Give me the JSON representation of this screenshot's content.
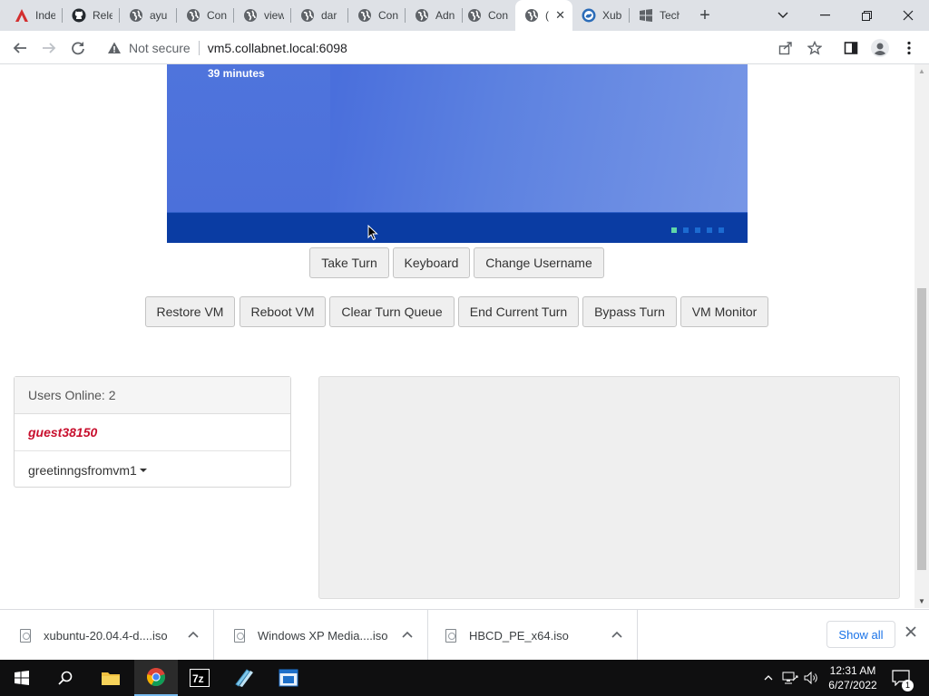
{
  "browser": {
    "tabs": [
      {
        "title": "Inde",
        "icon": "brand-a-icon"
      },
      {
        "title": "Rele",
        "icon": "github-icon"
      },
      {
        "title": "ayu",
        "icon": "globe-icon"
      },
      {
        "title": "Con",
        "icon": "globe-icon"
      },
      {
        "title": "view",
        "icon": "globe-icon"
      },
      {
        "title": "dar",
        "icon": "globe-icon"
      },
      {
        "title": "Con",
        "icon": "globe-icon"
      },
      {
        "title": "Adn",
        "icon": "globe-icon"
      },
      {
        "title": "Con",
        "icon": "globe-icon"
      },
      {
        "title": "(",
        "icon": "globe-icon",
        "active": true
      },
      {
        "title": "Xub",
        "icon": "xubuntu-icon"
      },
      {
        "title": "Tech",
        "icon": "windows-icon"
      }
    ],
    "address": {
      "security_label": "Not secure",
      "url": "vm5.collabnet.local:6098"
    }
  },
  "vm": {
    "message_line2": "39 minutes"
  },
  "controls": {
    "row1": [
      "Take Turn",
      "Keyboard",
      "Change Username"
    ],
    "row2": [
      "Restore VM",
      "Reboot VM",
      "Clear Turn Queue",
      "End Current Turn",
      "Bypass Turn",
      "VM Monitor"
    ]
  },
  "users": {
    "header": "Users Online: 2",
    "list": [
      "guest38150",
      "greetinngsfromvm1"
    ]
  },
  "downloads": {
    "items": [
      "xubuntu-20.04.4-d....iso",
      "Windows XP Media....iso",
      "HBCD_PE_x64.iso"
    ],
    "show_all": "Show all"
  },
  "taskbar": {
    "time": "12:31 AM",
    "date": "6/27/2022",
    "notification_count": "1"
  }
}
